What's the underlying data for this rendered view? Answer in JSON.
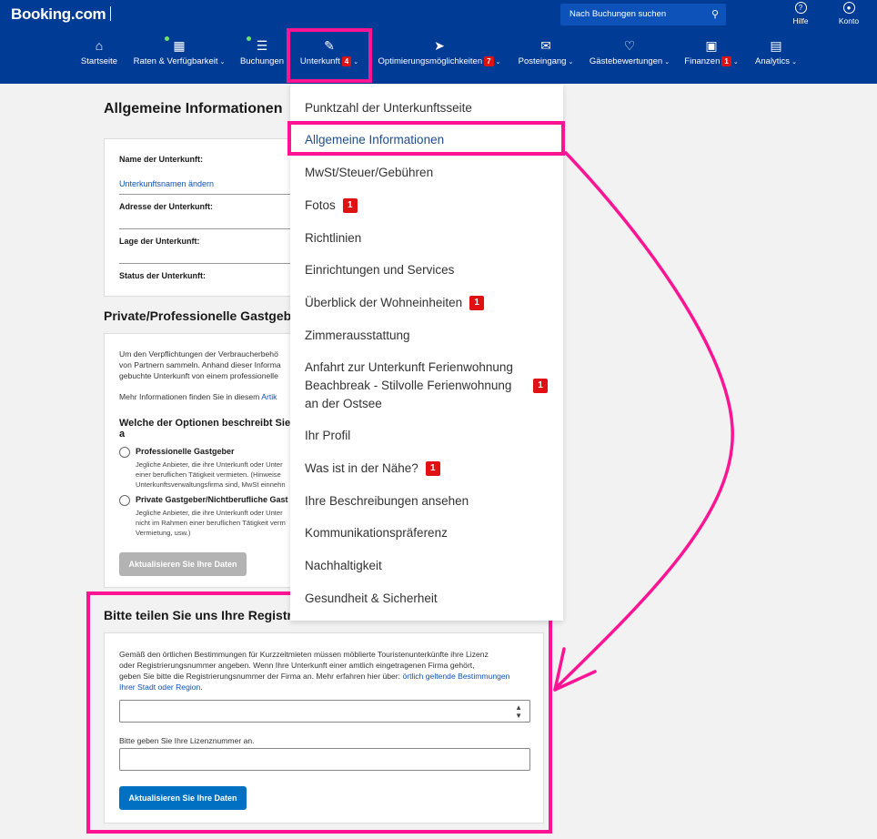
{
  "header": {
    "logo": "Booking.com",
    "search_placeholder": "Nach Buchungen suchen",
    "help_label": "Hilfe",
    "account_label": "Konto"
  },
  "nav": [
    {
      "label": "Startseite",
      "icon": "home-icon"
    },
    {
      "label": "Raten & Verfügbarkeit",
      "icon": "calendar-icon",
      "has_dot": true,
      "chevron": true
    },
    {
      "label": "Buchungen",
      "icon": "list-icon",
      "has_dot": true
    },
    {
      "label": "Unterkunft",
      "icon": "pencil-icon",
      "badge": "4",
      "chevron": true,
      "active": true
    },
    {
      "label": "Optimierungsmöglichkeiten",
      "icon": "rocket-icon",
      "badge": "7",
      "chevron": true
    },
    {
      "label": "Posteingang",
      "icon": "envelope-icon",
      "chevron": true
    },
    {
      "label": "Gästebewertungen",
      "icon": "heart-icon",
      "chevron": true
    },
    {
      "label": "Finanzen",
      "icon": "document-icon",
      "badge": "1",
      "chevron": true
    },
    {
      "label": "Analytics",
      "icon": "bar-chart-icon",
      "chevron": true
    }
  ],
  "main": {
    "title": "Allgemeine Informationen",
    "general_card": {
      "name_label": "Name der Unterkunft:",
      "change_name_link": "Unterkunftsnamen ändern",
      "address_label": "Adresse der Unterkunft:",
      "location_label": "Lage der Unterkunft:",
      "status_label": "Status der Unterkunft:"
    },
    "host_section": {
      "title": "Private/Professionelle Gastgeber",
      "intro_line1": "Um den Verpflichtungen der Verbraucherbehö",
      "intro_line2": "von Partnern sammeln. Anhand dieser Informa",
      "intro_line3": "gebuchte Unterkunft von einem professionelle",
      "more_info": "Mehr Informationen finden Sie in diesem",
      "more_info_link": "Artik",
      "question": "Welche der Optionen beschreibt Sie a",
      "option1_title": "Professionelle Gastgeber",
      "option1_line1": "Jegliche Anbieter, die ihre Unterkunft oder Unter",
      "option1_line2": "einer beruflichen Tätigkeit vermieten. (Hinweise",
      "option1_line3": "Unterkunftsverwaltungsfirma sind, MwSt einnehn",
      "option2_title": "Private Gastgeber/Nichtberufliche Gast",
      "option2_line1": "Jegliche Anbieter, die ihre Unterkunft oder Unter",
      "option2_line2": "nicht im Rahmen einer beruflichen Tätigkeit verm",
      "option2_line3": "Vermietung, usw.)",
      "update_button": "Aktualisieren Sie Ihre Daten"
    },
    "registration_section": {
      "title": "Bitte teilen Sie uns Ihre Registrier",
      "text_line1": "Gemäß den örtlichen Bestimmungen für Kurzzeitmieten müssen möblierte Touristenunterkünfte ihre Lizenz",
      "text_line2": "oder Registrierungsnummer angeben. Wenn Ihre Unterkunft einer amtlich eingetragenen Firma gehört,",
      "text_line3": "geben Sie bitte die Registrierungsnummer der Firma an. Mehr erfahren hier über:",
      "link_line3": "örtlich geltende Bestimmungen",
      "link_line4": "Ihrer Stadt oder Region",
      "text_line4_end": ".",
      "license_label": "Bitte geben Sie Ihre Lizenznummer an.",
      "update_button": "Aktualisieren Sie Ihre Daten"
    }
  },
  "dropdown": {
    "items": [
      {
        "label": "Punktzahl der Unterkunftsseite"
      },
      {
        "label": "Allgemeine Informationen",
        "selected": true
      },
      {
        "label": "MwSt/Steuer/Gebühren"
      },
      {
        "label": "Fotos",
        "badge": "1"
      },
      {
        "label": "Richtlinien"
      },
      {
        "label": "Einrichtungen und Services"
      },
      {
        "label": "Überblick der Wohneinheiten",
        "badge": "1"
      },
      {
        "label": "Zimmerausstattung"
      },
      {
        "label_lines": [
          "Anfahrt zur Unterkunft Ferienwohnung",
          "Beachbreak - Stilvolle Ferienwohnung",
          "an der Ostsee"
        ],
        "badge": "1"
      },
      {
        "label": "Ihr Profil"
      },
      {
        "label": "Was ist in der Nähe?",
        "badge": "1"
      },
      {
        "label": "Ihre Beschreibungen ansehen"
      },
      {
        "label": "Kommunikationspräferenz"
      },
      {
        "label": "Nachhaltigkeit"
      },
      {
        "label": "Gesundheit & Sicherheit"
      }
    ]
  },
  "colors": {
    "header_bg": "#003b95",
    "highlight": "#ff1493",
    "badge": "#e21111",
    "primary_button": "#0071c2"
  }
}
